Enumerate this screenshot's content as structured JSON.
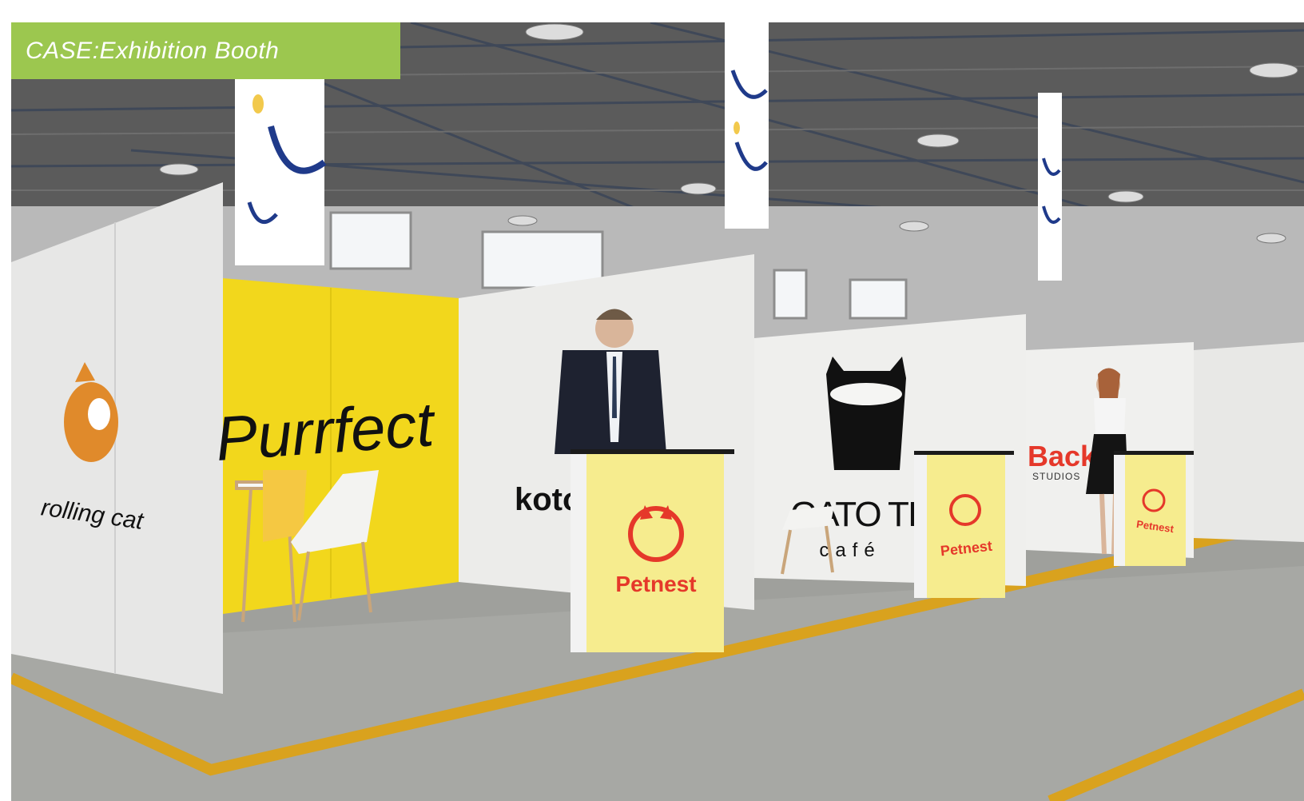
{
  "case_label": "CASE:Exhibition Booth",
  "booths": {
    "rolling_cat": "rolling cat",
    "purrfect": "Purrfect",
    "kotot": "kotot",
    "gato_tinto": "GATO TINT",
    "gato_tinto_sub": "café",
    "back": "Back",
    "back_sub": "STUDIOS"
  },
  "counters": {
    "brand": "Petnest"
  },
  "colors": {
    "accent": "#9cc74f",
    "booth_yellow": "#f2d71c",
    "counter_yellow": "#f6ec8e",
    "petnest_red": "#e5382a",
    "banner_blue": "#1f3a8a",
    "floor_stripe": "#d9a21e"
  }
}
